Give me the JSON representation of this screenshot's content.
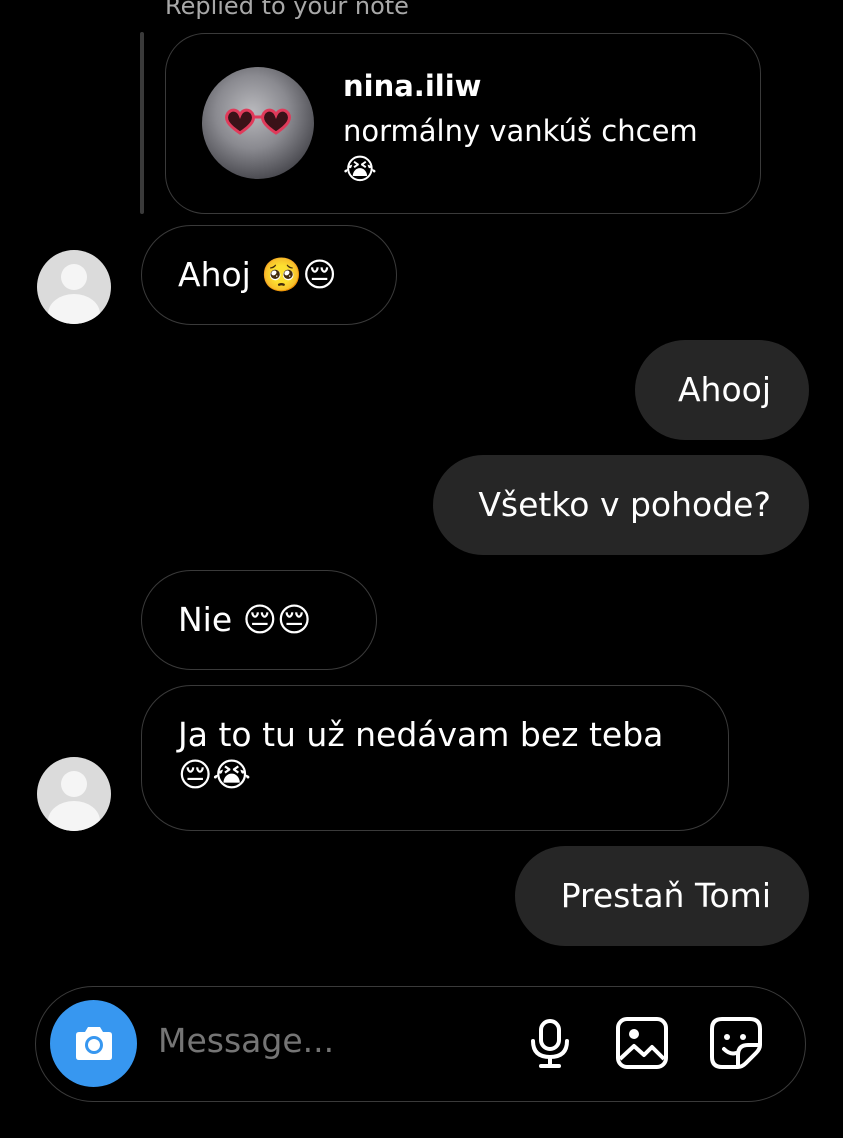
{
  "reply": {
    "label": "Replied to your note",
    "username": "nina.iliw",
    "note_text": "normálny vankúš chcem 😭"
  },
  "messages": [
    {
      "from": "them",
      "text": "Ahoj 🥺😔"
    },
    {
      "from": "me",
      "text": "Ahooj"
    },
    {
      "from": "me",
      "text": "Všetko v pohode?"
    },
    {
      "from": "them",
      "text": "Nie 😔😔"
    },
    {
      "from": "them",
      "text": "Ja to tu už nedávam bez teba 😔😭"
    },
    {
      "from": "me",
      "text": "Prestaň Tomi"
    }
  ],
  "composer": {
    "placeholder": "Message..."
  },
  "colors": {
    "background": "#000000",
    "outgoing_bubble": "#262626",
    "incoming_border": "#3a3a3a",
    "camera_button": "#3797f0"
  },
  "icons": [
    "camera-icon",
    "microphone-icon",
    "gallery-icon",
    "sticker-icon"
  ]
}
